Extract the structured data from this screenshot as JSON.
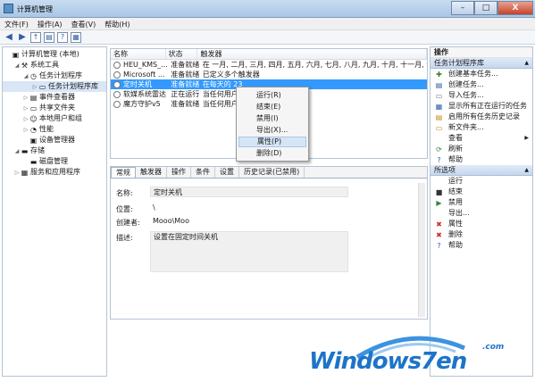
{
  "window": {
    "title": "计算机管理",
    "minimize": "–",
    "maximize": "□",
    "close": "X"
  },
  "menu": [
    "文件(F)",
    "操作(A)",
    "查看(V)",
    "帮助(H)"
  ],
  "tree": [
    {
      "label": "计算机管理 (本地)",
      "level": 0,
      "arrow": "",
      "icon": "computer-icon",
      "glyph": "▣"
    },
    {
      "label": "系统工具",
      "level": 1,
      "arrow": "◢",
      "icon": "tools-icon",
      "glyph": "⚒"
    },
    {
      "label": "任务计划程序",
      "level": 2,
      "arrow": "◢",
      "icon": "clock-icon",
      "glyph": "◷"
    },
    {
      "label": "任务计划程序库",
      "level": 3,
      "arrow": "▷",
      "icon": "folder-icon",
      "glyph": "▭",
      "selected": true
    },
    {
      "label": "事件查看器",
      "level": 2,
      "arrow": "▷",
      "icon": "event-viewer-icon",
      "glyph": "▤"
    },
    {
      "label": "共享文件夹",
      "level": 2,
      "arrow": "▷",
      "icon": "shared-folder-icon",
      "glyph": "▭"
    },
    {
      "label": "本地用户和组",
      "level": 2,
      "arrow": "▷",
      "icon": "users-icon",
      "glyph": "☺"
    },
    {
      "label": "性能",
      "level": 2,
      "arrow": "▷",
      "icon": "performance-icon",
      "glyph": "◔"
    },
    {
      "label": "设备管理器",
      "level": 2,
      "arrow": "",
      "icon": "device-manager-icon",
      "glyph": "▣"
    },
    {
      "label": "存储",
      "level": 1,
      "arrow": "◢",
      "icon": "storage-icon",
      "glyph": "▬"
    },
    {
      "label": "磁盘管理",
      "level": 2,
      "arrow": "",
      "icon": "disk-icon",
      "glyph": "▬"
    },
    {
      "label": "服务和应用程序",
      "level": 1,
      "arrow": "▷",
      "icon": "services-icon",
      "glyph": "▦"
    }
  ],
  "list": {
    "columns": [
      "名称",
      "状态",
      "触发器"
    ],
    "rows": [
      {
        "name": "HEU_KMS_...",
        "status": "准备就绪",
        "trigger": "在 一月, 二月, 三月, 四月, 五月, 六月, 七月, 八月, 九月, 十月, 十一月, 十二月 的"
      },
      {
        "name": "Microsoft ...",
        "status": "准备就绪",
        "trigger": "已定义多个触发器"
      },
      {
        "name": "定时关机",
        "status": "准备就绪",
        "trigger": "在每天的 23",
        "selected": true
      },
      {
        "name": "软媒系统雷达",
        "status": "正在运行",
        "trigger": "当任何用户登"
      },
      {
        "name": "魔方守护v5",
        "status": "准备就绪",
        "trigger": "当任何用户登"
      }
    ]
  },
  "tabs": [
    "常规",
    "触发器",
    "操作",
    "条件",
    "设置",
    "历史记录(已禁用)"
  ],
  "detail": {
    "name_label": "名称:",
    "name_value": "定时关机",
    "location_label": "位置:",
    "location_value": "\\",
    "author_label": "创建者:",
    "author_value": "Mooo\\Moo",
    "desc_label": "描述:",
    "desc_value": "设置在固定时间关机"
  },
  "context_menu": [
    {
      "label": "运行(R)"
    },
    {
      "label": "结束(E)"
    },
    {
      "label": "禁用(I)"
    },
    {
      "label": "导出(X)..."
    },
    {
      "label": "属性(P)",
      "highlighted": true
    },
    {
      "label": "删除(D)"
    }
  ],
  "actions": {
    "title": "操作",
    "section1": "任务计划程序库",
    "items1": [
      {
        "label": "创建基本任务...",
        "icon": "create-basic-task-icon",
        "glyph": "✚",
        "color": "#3a7d2c"
      },
      {
        "label": "创建任务...",
        "icon": "create-task-icon",
        "glyph": "▤",
        "color": "#2e5fa5"
      },
      {
        "label": "导入任务...",
        "icon": "import-task-icon",
        "glyph": "▭",
        "color": "#777777"
      },
      {
        "label": "显示所有正在运行的任务",
        "icon": "running-tasks-icon",
        "glyph": "▦",
        "color": "#2e5fa5"
      },
      {
        "label": "启用所有任务历史记录",
        "icon": "history-icon",
        "glyph": "▤",
        "color": "#c48b1c"
      },
      {
        "label": "新文件夹...",
        "icon": "new-folder-icon",
        "glyph": "▭",
        "color": "#c48b1c"
      },
      {
        "label": "查看",
        "icon": "view-icon",
        "glyph": "",
        "color": "#333333",
        "submenu": true
      },
      {
        "label": "刷新",
        "icon": "refresh-icon",
        "glyph": "⟳",
        "color": "#2e8b3a"
      },
      {
        "label": "帮助",
        "icon": "help-icon",
        "glyph": "?",
        "color": "#2e5fa5"
      }
    ],
    "section2": "所选项",
    "items2": [
      {
        "label": "运行",
        "icon": "run-icon",
        "glyph": "",
        "color": "#333333"
      },
      {
        "label": "结束",
        "icon": "end-icon",
        "glyph": "■",
        "color": "#333333"
      },
      {
        "label": "禁用",
        "icon": "disable-icon",
        "glyph": "▶",
        "color": "#2e8b3a"
      },
      {
        "label": "导出...",
        "icon": "export-icon",
        "glyph": "",
        "color": "#333333"
      },
      {
        "label": "属性",
        "icon": "properties-icon",
        "glyph": "✖",
        "color": "#c9302c"
      },
      {
        "label": "删除",
        "icon": "delete-icon",
        "glyph": "✖",
        "color": "#c9302c"
      },
      {
        "label": "帮助",
        "icon": "help-icon",
        "glyph": "?",
        "color": "#2e5fa5"
      }
    ]
  },
  "watermark": {
    "text": "Windows7en",
    "suffix": ".com",
    "color": "#1d74c8"
  }
}
